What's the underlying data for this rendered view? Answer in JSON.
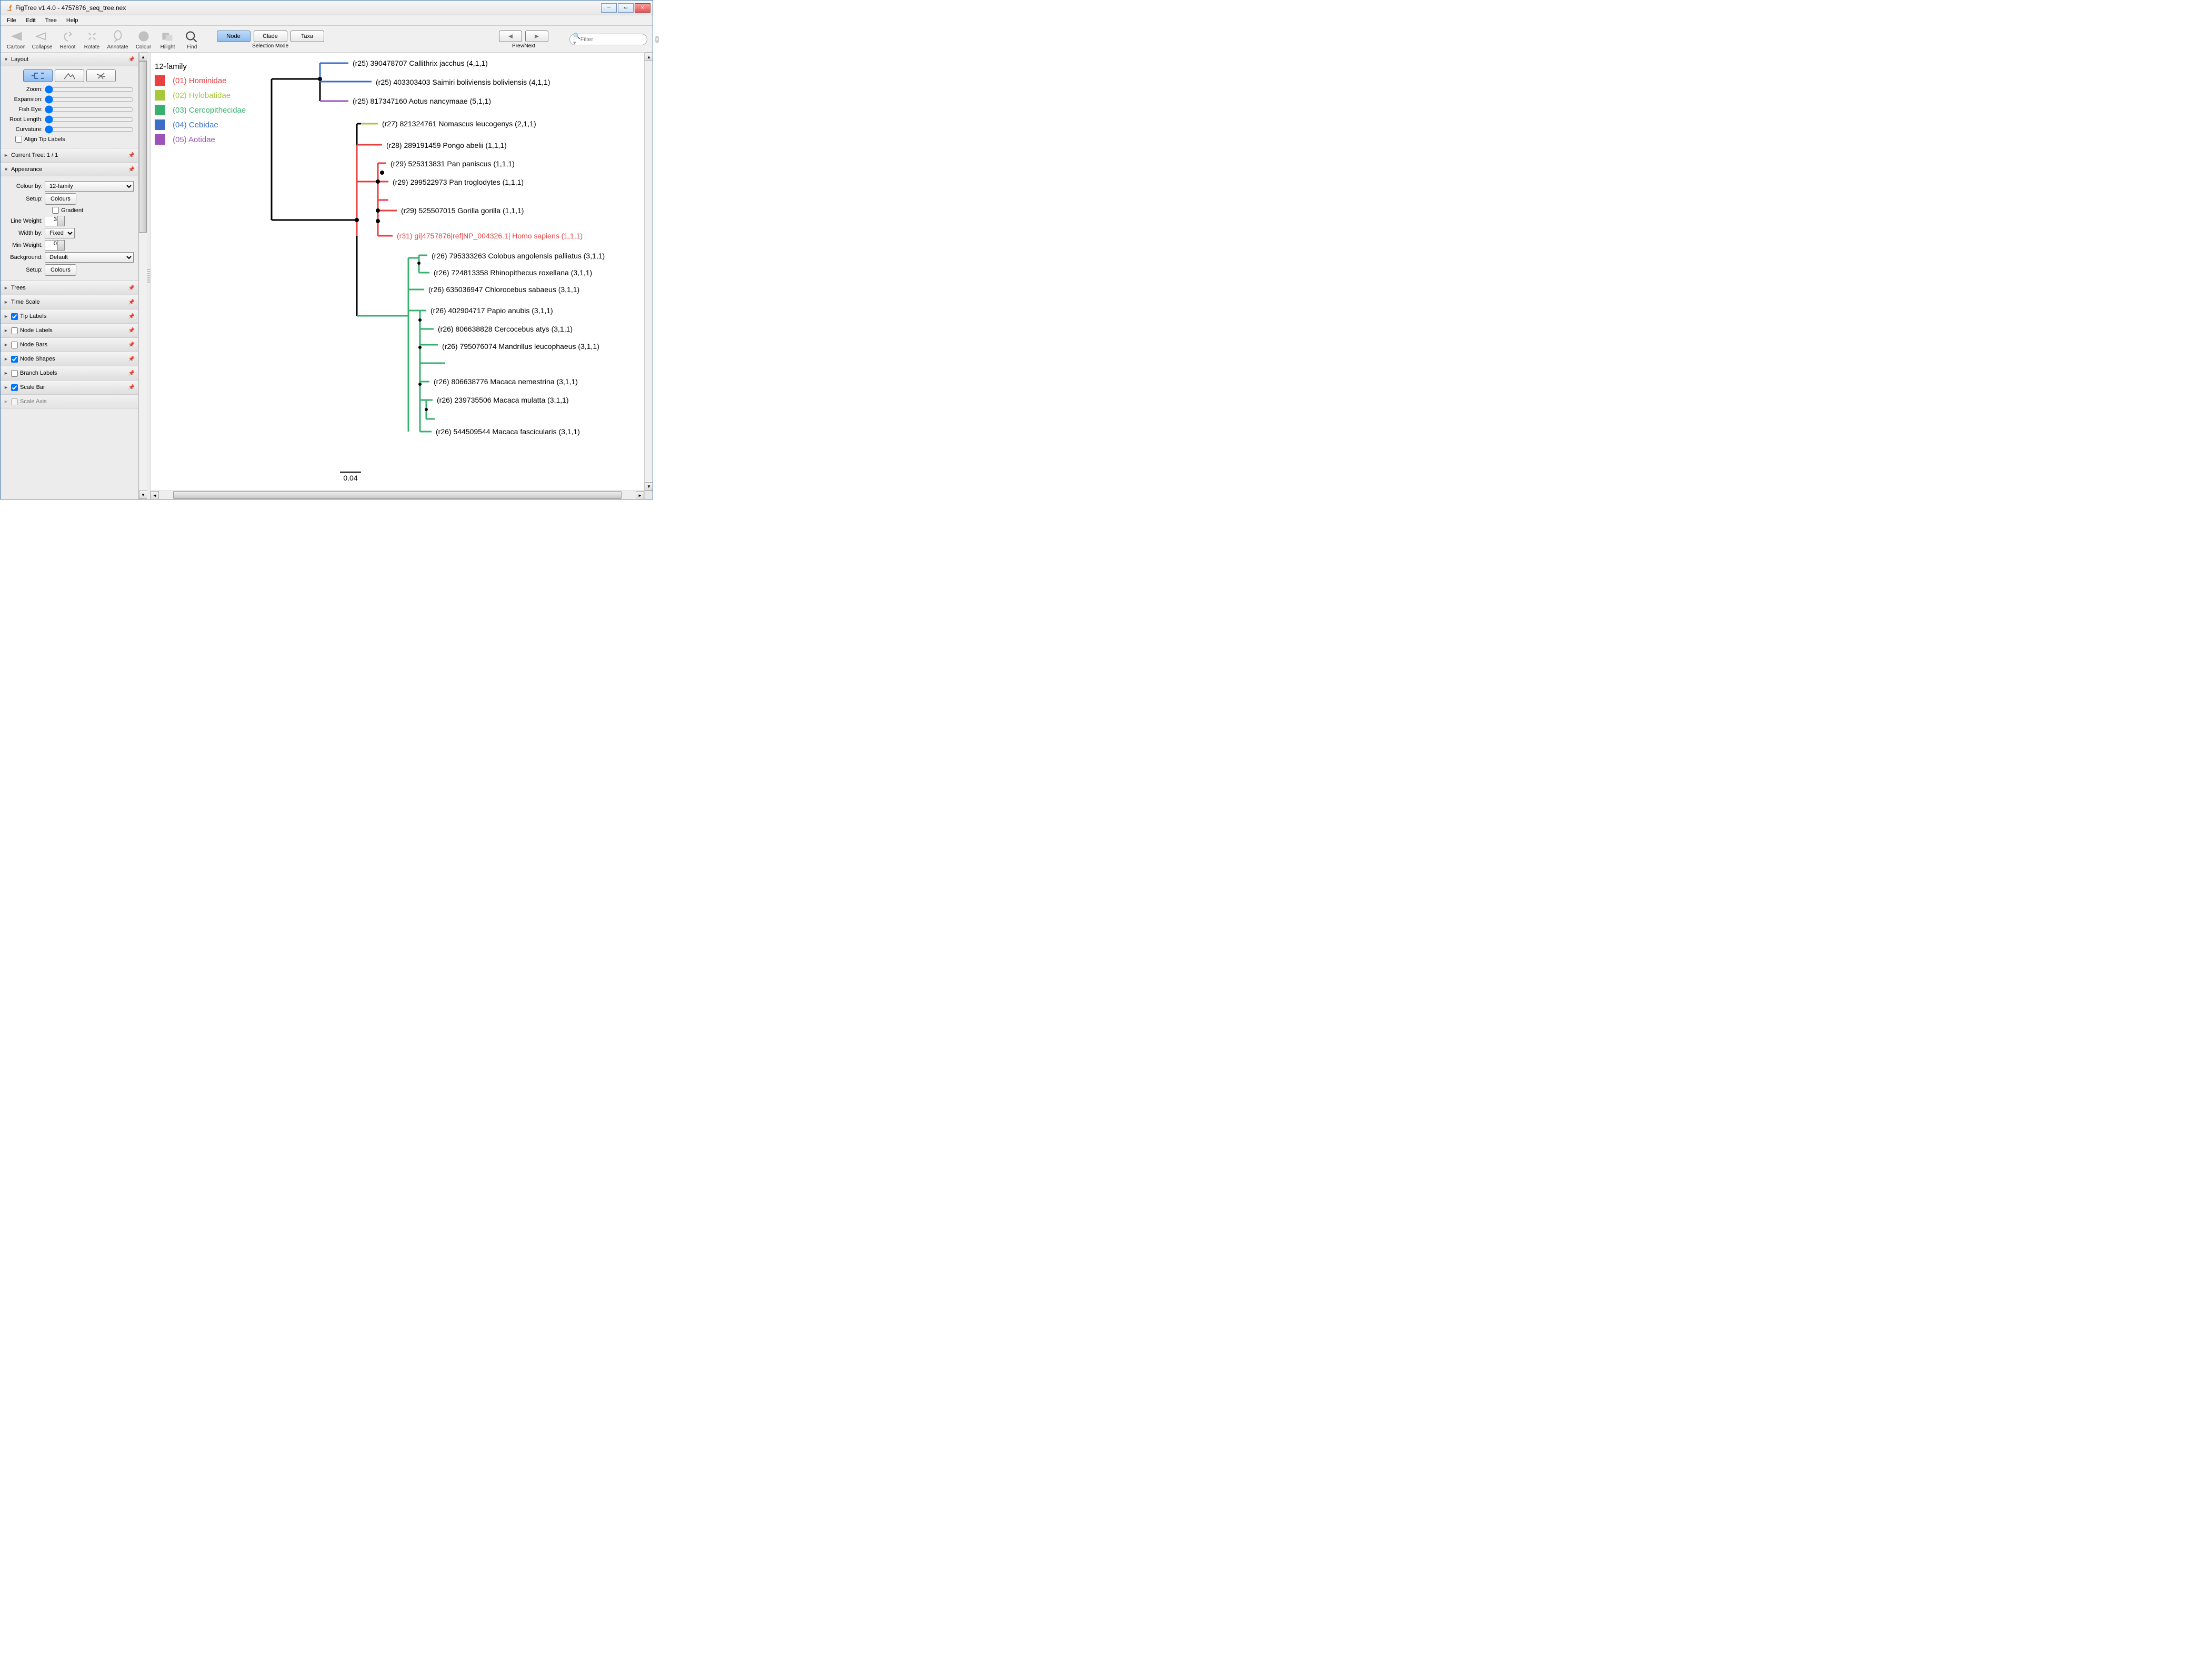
{
  "window": {
    "title": "FigTree v1.4.0 - 4757876_seq_tree.nex"
  },
  "menus": [
    "File",
    "Edit",
    "Tree",
    "Help"
  ],
  "toolbar": {
    "items": [
      "Cartoon",
      "Collapse",
      "Reroot",
      "Rotate",
      "Annotate",
      "Colour",
      "Hilight",
      "Find"
    ],
    "selection_mode_label": "Selection Mode",
    "mode_buttons": {
      "node": "Node",
      "clade": "Clade",
      "taxa": "Taxa"
    },
    "prev_next_label": "Prev/Next",
    "filter_placeholder": "Filter"
  },
  "sidebar": {
    "layout": {
      "title": "Layout",
      "zoom": "Zoom:",
      "expansion": "Expansion:",
      "fisheye": "Fish Eye:",
      "root_length": "Root Length:",
      "curvature": "Curvature:",
      "align_tips": "Align Tip Labels"
    },
    "current_tree": {
      "title": "Current Tree: 1 / 1"
    },
    "appearance": {
      "title": "Appearance",
      "colour_by_label": "Colour by:",
      "colour_by_value": "12-family",
      "setup_label": "Setup:",
      "colours_btn": "Colours",
      "gradient": "Gradient",
      "line_weight_label": "Line Weight:",
      "line_weight_value": "3",
      "width_by_label": "Width by:",
      "width_by_value": "Fixed",
      "min_weight_label": "Min Weight:",
      "min_weight_value": "0",
      "background_label": "Background:",
      "background_value": "Default"
    },
    "others": {
      "trees": "Trees",
      "time_scale": "Time Scale",
      "tip_labels": "Tip Labels",
      "node_labels": "Node Labels",
      "node_bars": "Node Bars",
      "node_shapes": "Node Shapes",
      "branch_labels": "Branch Labels",
      "scale_bar": "Scale Bar",
      "scale_axis": "Scale Axis"
    }
  },
  "tree": {
    "legend_title": "12-family",
    "legend": [
      {
        "id": "01",
        "label": "(01) Hominidae",
        "color": "#e84040"
      },
      {
        "id": "02",
        "label": "(02) Hylobatidae",
        "color": "#a8c83c"
      },
      {
        "id": "03",
        "label": "(03) Cercopithecidae",
        "color": "#38b070"
      },
      {
        "id": "04",
        "label": "(04) Cebidae",
        "color": "#3c6ec8"
      },
      {
        "id": "05",
        "label": "(05) Aotidae",
        "color": "#9c54b8"
      }
    ],
    "tips": [
      {
        "text": "(r25) 390478707 Callithrix jacchus (4,1,1)"
      },
      {
        "text": "(r25) 403303403 Saimiri boliviensis boliviensis (4,1,1)"
      },
      {
        "text": "(r25) 817347160 Aotus nancymaae (5,1,1)"
      },
      {
        "text": "(r27) 821324761 Nomascus leucogenys (2,1,1)"
      },
      {
        "text": "(r28) 289191459 Pongo abelii (1,1,1)"
      },
      {
        "text": "(r29) 525313831 Pan paniscus (1,1,1)"
      },
      {
        "text": "(r29) 299522973 Pan troglodytes (1,1,1)"
      },
      {
        "text": "(r29) 525507015 Gorilla gorilla (1,1,1)"
      },
      {
        "text": "(r31) gi|4757876|ref|NP_004326.1| Homo sapiens (1,1,1)",
        "highlight": true
      },
      {
        "text": "(r26) 795333263 Colobus angolensis palliatus (3,1,1)"
      },
      {
        "text": "(r26) 724813358 Rhinopithecus roxellana (3,1,1)"
      },
      {
        "text": "(r26) 635036947 Chlorocebus sabaeus (3,1,1)"
      },
      {
        "text": "(r26) 402904717 Papio anubis (3,1,1)"
      },
      {
        "text": "(r26) 806638828 Cercocebus atys (3,1,1)"
      },
      {
        "text": "(r26) 795076074 Mandrillus leucophaeus (3,1,1)"
      },
      {
        "text": "(r26) 806638776 Macaca nemestrina (3,1,1)"
      },
      {
        "text": "(r26) 239735506 Macaca mulatta (3,1,1)"
      },
      {
        "text": "(r26) 544509544 Macaca fascicularis (3,1,1)"
      }
    ],
    "scale_value": "0.04"
  },
  "colors": {
    "black": "#000000",
    "red": "#e84040",
    "olive": "#a8c83c",
    "green": "#38b070",
    "blue": "#3c6ec8",
    "purple": "#9c54b8"
  }
}
